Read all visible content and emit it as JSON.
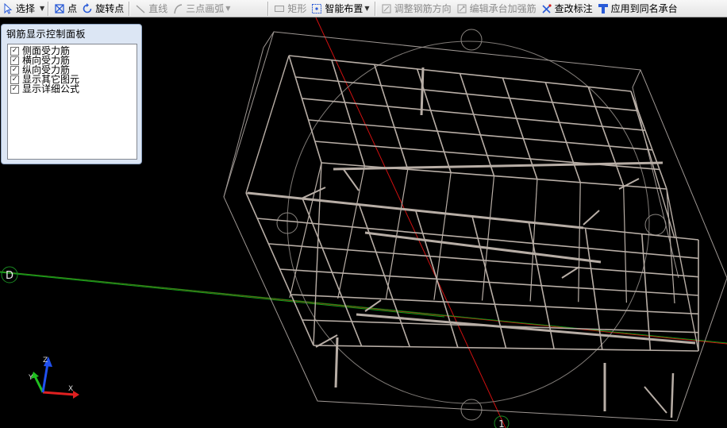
{
  "toolbar": {
    "select": "选择",
    "point": "点",
    "rotate_point": "旋转点",
    "line": "直线",
    "arc": "三点画弧",
    "rect": "矩形",
    "smart": "智能布置",
    "adjust": "调整钢筋方向",
    "edit": "编辑承台加强筋",
    "check": "查改标注",
    "apply": "应用到同名承台"
  },
  "panel": {
    "title": "钢筋显示控制面板",
    "options": [
      {
        "label": "侧面受力筋",
        "checked": true
      },
      {
        "label": "横向受力筋",
        "checked": true
      },
      {
        "label": "纵向受力筋",
        "checked": true
      },
      {
        "label": "显示其它图元",
        "checked": true
      },
      {
        "label": "显示详细公式",
        "checked": true
      }
    ]
  },
  "viewport": {
    "axis_d": "D",
    "axis_1": "1",
    "ucs": {
      "z": "Z",
      "y": "Y",
      "x": "X"
    }
  },
  "colors": {
    "rebar": "#b8aea6",
    "x_axis_line": "#d01010",
    "y_axis_line": "#0fa51a",
    "ucs_x": "#e02020",
    "ucs_y": "#20c020",
    "ucs_z": "#2050f0"
  }
}
